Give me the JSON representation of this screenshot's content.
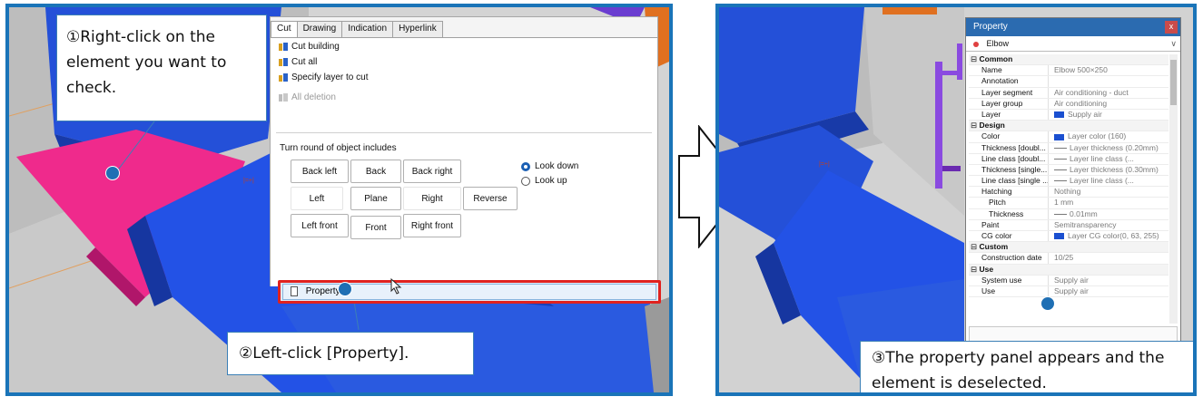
{
  "callouts": {
    "step1": "①Right-click on the element you want to check.",
    "step2": "②Left-click [Property].",
    "step3": "③The property panel appears and the element is deselected."
  },
  "context_menu": {
    "tabs": [
      "Cut",
      "Drawing",
      "Indication",
      "Hyperlink"
    ],
    "items": [
      {
        "label": "Cut building",
        "enabled": true
      },
      {
        "label": "Cut all",
        "enabled": true
      },
      {
        "label": "Specify layer to cut",
        "enabled": true
      },
      {
        "label": "All deletion",
        "enabled": false
      }
    ],
    "turn_round_label": "Turn round of object includes",
    "view_buttons": [
      "Back left",
      "Back",
      "Back right",
      "Left",
      "Plane",
      "Right",
      "Reverse",
      "Left front",
      "Front",
      "Right front"
    ],
    "radios": [
      {
        "label": "Look down",
        "selected": true
      },
      {
        "label": "Look up",
        "selected": false
      }
    ],
    "property_label": "Property"
  },
  "property_panel": {
    "title": "Property",
    "close_label": "x",
    "selected_object": "Elbow",
    "rows": [
      {
        "kind": "cat",
        "key": "Common"
      },
      {
        "key": "Name",
        "value": "Elbow 500×250"
      },
      {
        "key": "Annotation",
        "value": ""
      },
      {
        "key": "Layer segment",
        "value": "Air conditioning - duct"
      },
      {
        "key": "Layer group",
        "value": "Air conditioning"
      },
      {
        "key": "Layer",
        "value": "Supply air",
        "swatch": "#1a4fd0"
      },
      {
        "kind": "cat",
        "key": "Design"
      },
      {
        "key": "Color",
        "value": "Layer color (160)",
        "swatch": "#1a4fd0"
      },
      {
        "key": "Thickness [doubl...",
        "value": "Layer thickness (0.20mm)",
        "line": true
      },
      {
        "key": "Line class [doubl...",
        "value": "Layer line class (...",
        "line": true
      },
      {
        "key": "Thickness [single...",
        "value": "Layer thickness (0.30mm)",
        "line": true
      },
      {
        "key": "Line class [single ...",
        "value": "Layer line class (...",
        "line": true
      },
      {
        "key": "Hatching",
        "value": "Nothing"
      },
      {
        "kind": "sub",
        "key": "Pitch",
        "value": "1 mm"
      },
      {
        "kind": "sub",
        "key": "Thickness",
        "value": "0.01mm",
        "line": true
      },
      {
        "key": "Paint",
        "value": "Semitransparency"
      },
      {
        "key": "CG color",
        "value": "Layer CG color(0, 63, 255)",
        "swatch": "#1a4fd0"
      },
      {
        "kind": "cat",
        "key": "Custom"
      },
      {
        "key": "Construction date",
        "value": "10/25"
      },
      {
        "kind": "cat",
        "key": "Use"
      },
      {
        "key": "System use",
        "value": "Supply air"
      },
      {
        "key": "Use",
        "value": "Supply air"
      }
    ]
  },
  "colors": {
    "frame": "#1a74b8",
    "duct_blue": "#1f48d8",
    "elbow_pink": "#ef2a8c",
    "highlight_red": "#e0221f"
  }
}
